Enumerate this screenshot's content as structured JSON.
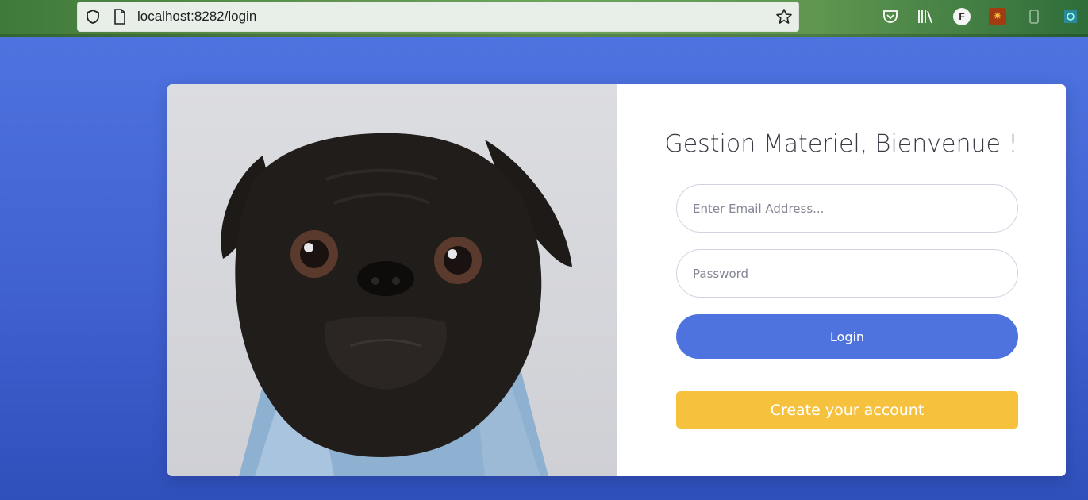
{
  "browser": {
    "url": "localhost:8282/login",
    "profile_initial": "F"
  },
  "login": {
    "title": "Gestion Materiel, Bienvenue !",
    "email_placeholder": "Enter Email Address...",
    "password_placeholder": "Password",
    "login_label": "Login",
    "create_account_label": "Create your account"
  },
  "colors": {
    "background": "#4e73df",
    "primary_button": "#4e73df",
    "create_button": "#f6c23e",
    "card": "#ffffff"
  },
  "icons": [
    "shield-icon",
    "page-icon",
    "bookmark-star-icon",
    "pocket-icon",
    "library-icon",
    "profile-avatar",
    "extension-icon"
  ]
}
